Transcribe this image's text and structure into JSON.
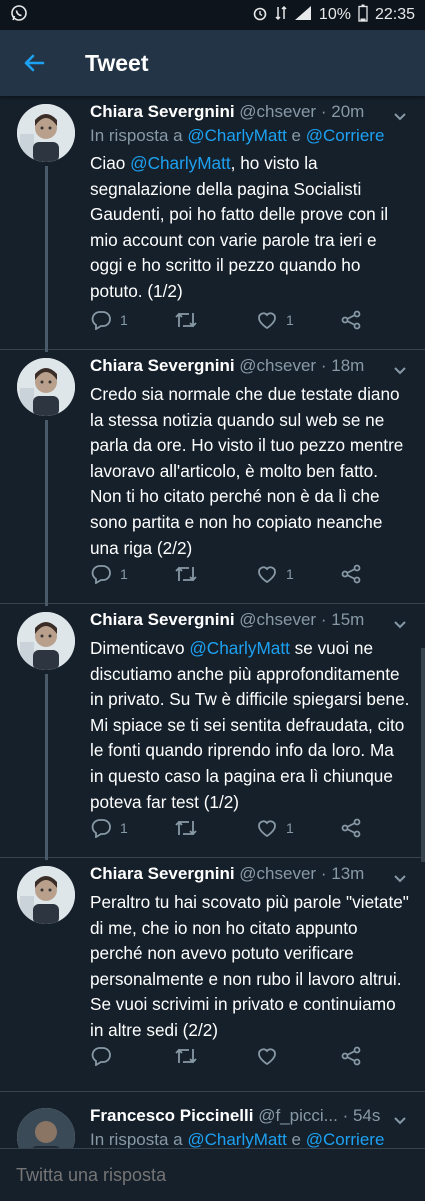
{
  "status": {
    "battery": "10%",
    "time": "22:35"
  },
  "header": {
    "title": "Tweet"
  },
  "tweets": [
    {
      "name": "Chiara Severgnini",
      "handle": "@chsever",
      "time": "20m",
      "reply_to": {
        "prefix": "In risposta a",
        "user1": "@CharlyMatt",
        "sep": "e",
        "user2": "@Corriere"
      },
      "text_mention": "@CharlyMatt",
      "text_prefix": "Ciao ",
      "text": ", ho visto la segnalazione della pagina Socialisti Gaudenti, poi ho fatto delle prove con il mio account con varie parole tra ieri e oggi e ho scritto il pezzo quando ho potuto. (1/2)",
      "replies": "1",
      "likes": "1"
    },
    {
      "name": "Chiara Severgnini",
      "handle": "@chsever",
      "time": "18m",
      "text": "Credo sia normale che due testate diano la stessa notizia quando sul web se ne parla da ore. Ho visto il tuo pezzo mentre lavoravo all'articolo, è molto ben fatto. Non ti ho citato perché non è da lì che sono partita e non ho copiato neanche una riga (2/2)",
      "replies": "1",
      "likes": "1"
    },
    {
      "name": "Chiara Severgnini",
      "handle": "@chsever",
      "time": "15m",
      "text_prefix": "Dimenticavo ",
      "text_mention": "@CharlyMatt",
      "text": " se vuoi ne discutiamo anche più approfonditamente in privato. Su Tw è difficile spiegarsi bene. Mi spiace se ti sei sentita defraudata, cito le fonti quando riprendo info da loro. Ma in questo caso la pagina era lì chiunque poteva far test (1/2)",
      "replies": "1",
      "likes": "1"
    },
    {
      "name": "Chiara Severgnini",
      "handle": "@chsever",
      "time": "13m",
      "text": "Peraltro tu hai scovato più parole \"vietate\" di me, che io non ho citato appunto perché non avevo potuto verificare personalmente e non rubo il lavoro altrui. Se vuoi scrivimi in privato e continuiamo in altre sedi (2/2)",
      "replies": "",
      "likes": ""
    },
    {
      "name": "Francesco Piccinelli",
      "handle": "@f_picci...",
      "time": "54s",
      "reply_to": {
        "prefix": "In risposta a",
        "user1": "@CharlyMatt",
        "sep": "e",
        "user2": "@Corriere"
      }
    }
  ],
  "compose": {
    "placeholder": "Twitta una risposta"
  },
  "colors": {
    "background": "#15202b",
    "header": "#243447",
    "link": "#1da1f2",
    "secondary": "#8899a6"
  }
}
